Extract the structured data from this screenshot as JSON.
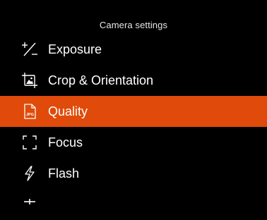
{
  "header": {
    "title": "Camera settings"
  },
  "menu": {
    "items": [
      {
        "label": "Exposure",
        "icon": "exposure-icon",
        "selected": false
      },
      {
        "label": "Crop & Orientation",
        "icon": "crop-icon",
        "selected": false
      },
      {
        "label": "Quality",
        "icon": "jpg-file-icon",
        "icon_text": "JPG",
        "selected": true
      },
      {
        "label": "Focus",
        "icon": "focus-frame-icon",
        "selected": false
      },
      {
        "label": "Flash",
        "icon": "flash-icon",
        "selected": false
      }
    ]
  },
  "colors": {
    "background": "#000000",
    "selected": "#e04a0a",
    "text": "#ffffff"
  }
}
